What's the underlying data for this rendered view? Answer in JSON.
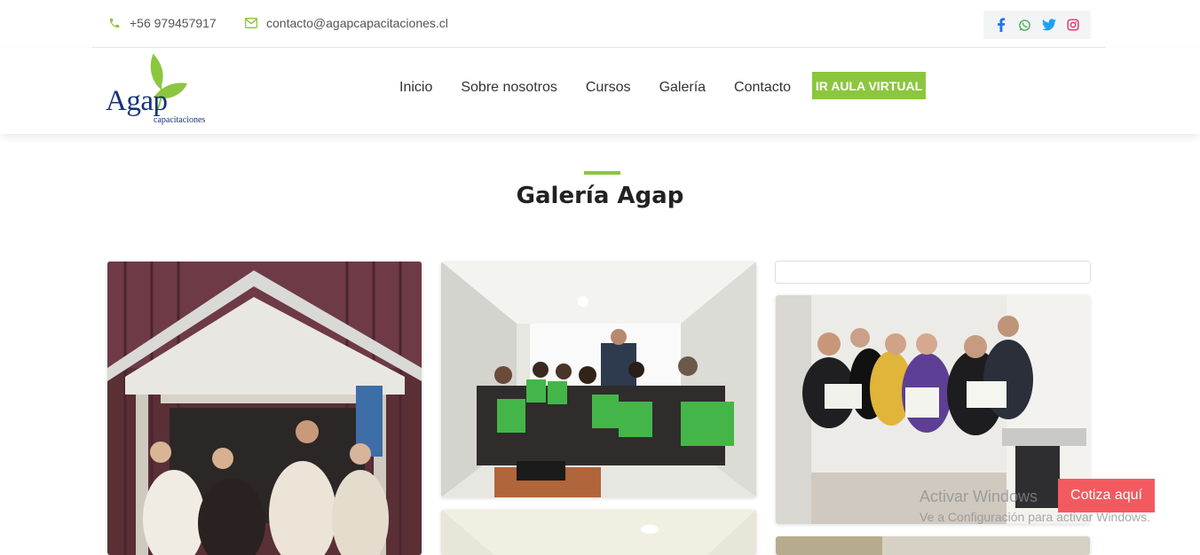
{
  "topbar": {
    "phone": "+56 979457917",
    "email": "contacto@agapcapacitaciones.cl",
    "social": [
      {
        "icon": "facebook-icon",
        "color": "#1877f2"
      },
      {
        "icon": "whatsapp-icon",
        "color": "#4caf50"
      },
      {
        "icon": "twitter-icon",
        "color": "#1da1f2"
      },
      {
        "icon": "instagram-icon",
        "color": "#d6336c"
      }
    ]
  },
  "header": {
    "logo_text": "Agap",
    "logo_sub": "capacitaciones",
    "nav": [
      "Inicio",
      "Sobre nosotros",
      "Cursos",
      "Galería",
      "Contacto"
    ],
    "cta": "IR AULA VIRTUAL"
  },
  "gallery": {
    "title": "Galería Agap"
  },
  "overlay": {
    "watermark_title": "Activar Windows",
    "watermark_sub": "Ve a Configuración para activar Windows.",
    "quote_button": "Cotiza aquí"
  },
  "colors": {
    "accent": "#8cc63f",
    "brand": "#15337a",
    "quote": "#f25a5f"
  }
}
